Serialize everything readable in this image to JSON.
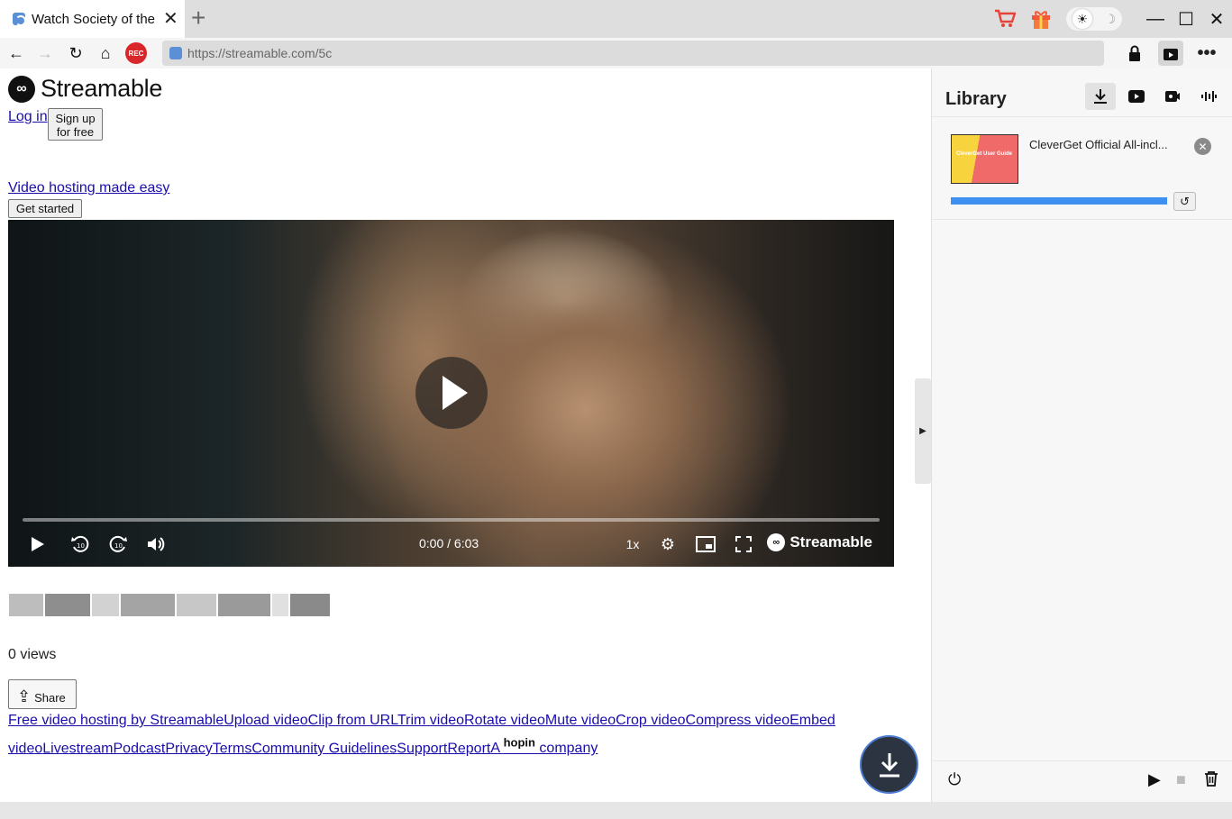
{
  "browser": {
    "tab_title": "Watch Society of the",
    "url": "https://streamable.com/5c",
    "icons": [
      "cart-icon",
      "gift-icon",
      "sun-icon",
      "moon-icon",
      "minimize-icon",
      "maximize-icon",
      "close-icon"
    ]
  },
  "nav": {
    "rec_label": "REC"
  },
  "page": {
    "logo_text": "Streamable",
    "login_label": "Log in",
    "signup_label": "Sign up for free",
    "hosting_link": "Video hosting made easy",
    "get_started_label": "Get started",
    "video": {
      "time": "0:00 / 6:03",
      "speed": "1x",
      "brand": "Streamable",
      "progress": 0
    },
    "views": "0 views",
    "share_label": "Share",
    "footer": {
      "links": [
        "Free video hosting by Streamable",
        "Upload video",
        "Clip from URL",
        "Trim video",
        "Rotate video",
        "Mute video",
        "Crop video",
        "Compress video",
        "Embed video",
        "Livestream",
        "Podcast",
        "Privacy",
        "Terms",
        "Community Guidelines",
        "Support",
        "Report"
      ],
      "company_prefix": "A ",
      "company_brand": "hopin",
      "company_suffix": " company"
    }
  },
  "library": {
    "title": "Library",
    "item": {
      "name": "CleverGet Official  All-incl...",
      "thumb_text": "CleverGet User Guide",
      "progress": 1.0
    }
  },
  "colors": {
    "accent": "#3d8ff0",
    "rec": "#d9262a",
    "link": "#1a0dab",
    "fab": "#2b3440"
  }
}
